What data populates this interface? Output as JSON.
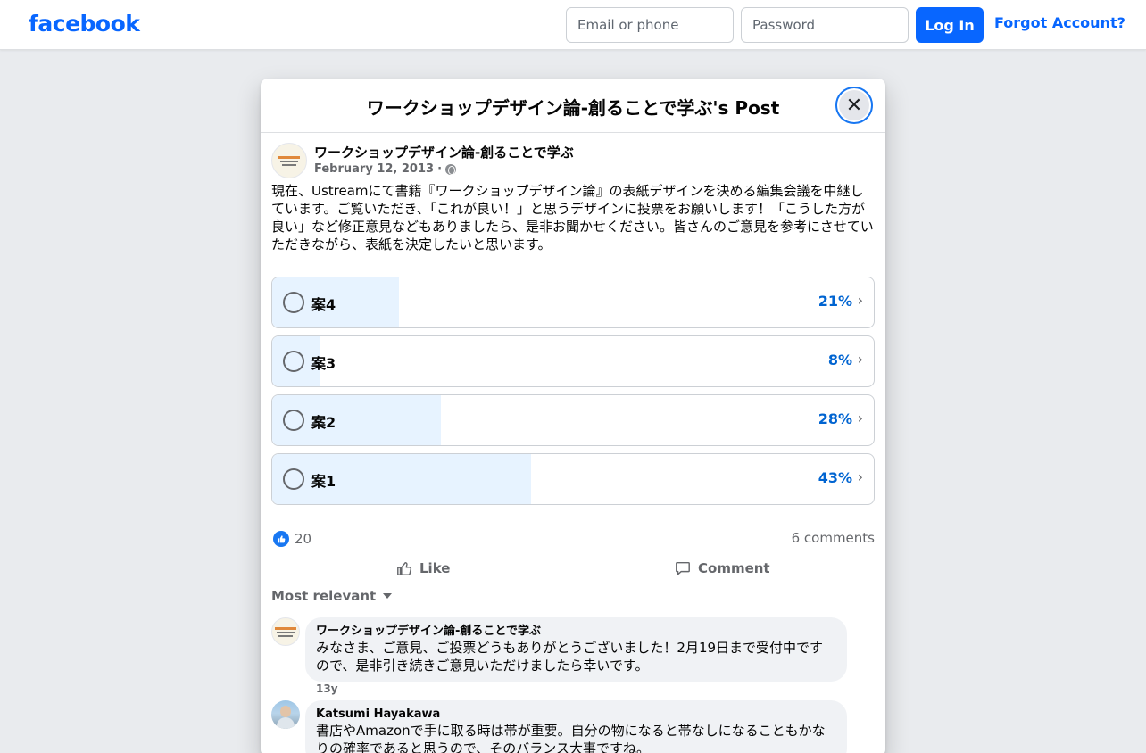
{
  "topbar": {
    "logo": "facebook",
    "email_placeholder": "Email or phone",
    "password_placeholder": "Password",
    "login_label": "Log In",
    "forgot_label": "Forgot Account?"
  },
  "modal": {
    "title": "ワークショップデザイン論-創ることで学ぶ's Post",
    "close_symbol": "✕"
  },
  "post": {
    "author": "ワークショップデザイン論-創ることで学ぶ",
    "date": "February 12, 2013",
    "separator": "·",
    "text": "現在、Ustreamにて書籍『ワークショップデザイン論』の表紙デザインを決める編集会議を中継しています。ご覧いただき、「これが良い！」と思うデザインに投票をお願いします！「こうした方が良い」など修正意見などもありましたら、是非お聞かせください。皆さんのご意見を参考にさせていただきながら、表紙を決定したいと思います。"
  },
  "poll": {
    "options": [
      {
        "label": "案4",
        "percent_label": "21%",
        "percent": 21
      },
      {
        "label": "案3",
        "percent_label": "8%",
        "percent": 8
      },
      {
        "label": "案2",
        "percent_label": "28%",
        "percent": 28
      },
      {
        "label": "案1",
        "percent_label": "43%",
        "percent": 43
      }
    ],
    "chevron": "›"
  },
  "stats": {
    "like_count": "20",
    "comment_count": "6 comments"
  },
  "actions": {
    "like": "Like",
    "comment": "Comment"
  },
  "sort": {
    "label": "Most relevant"
  },
  "comments": [
    {
      "name": "ワークショップデザイン論-創ることで学ぶ",
      "text": "みなさま、ご意見、ご投票どうもありがとうございました！2月19日まで受付中ですので、是非引き続きご意見いただけましたら幸いです。",
      "time": "13y"
    },
    {
      "name": "Katsumi Hayakawa",
      "text": "書店やAmazonで手に取る時は帯が重要。自分の物になると帯なしになることもかなりの確率であると思うので、そのバランス大事ですね。"
    }
  ],
  "colors": {
    "brand": "#0866ff",
    "poll_fill": "#e7f3ff",
    "percent_text": "#0064d1"
  }
}
